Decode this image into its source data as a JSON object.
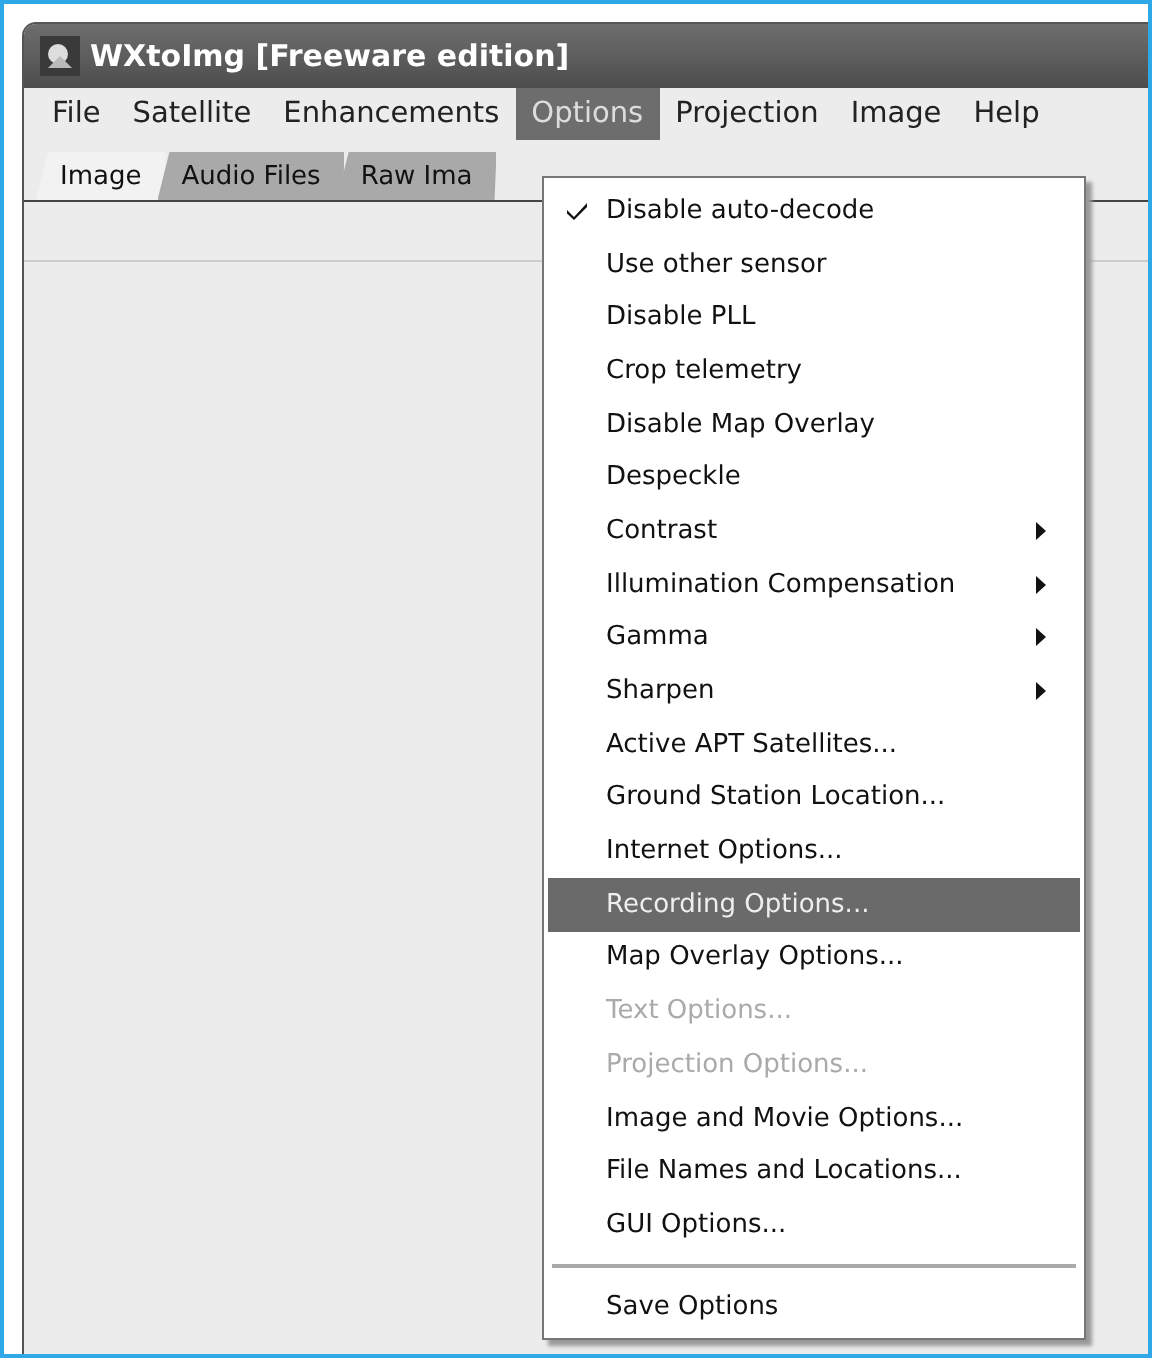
{
  "window": {
    "title": "WXtoImg [Freeware edition]"
  },
  "menubar": [
    {
      "label": "File",
      "selected": false
    },
    {
      "label": "Satellite",
      "selected": false
    },
    {
      "label": "Enhancements",
      "selected": false
    },
    {
      "label": "Options",
      "selected": true
    },
    {
      "label": "Projection",
      "selected": false
    },
    {
      "label": "Image",
      "selected": false
    },
    {
      "label": "Help",
      "selected": false
    }
  ],
  "tabs": [
    {
      "label": "Image",
      "selected": true
    },
    {
      "label": "Audio Files",
      "selected": false
    },
    {
      "label": "Raw Ima",
      "selected": false
    }
  ],
  "menu": [
    {
      "kind": "item",
      "label": "Disable auto-decode",
      "checked": true,
      "submenu": false,
      "disabled": false,
      "selected": false
    },
    {
      "kind": "item",
      "label": "Use other sensor",
      "checked": false,
      "submenu": false,
      "disabled": false,
      "selected": false
    },
    {
      "kind": "item",
      "label": "Disable PLL",
      "checked": false,
      "submenu": false,
      "disabled": false,
      "selected": false
    },
    {
      "kind": "item",
      "label": "Crop telemetry",
      "checked": false,
      "submenu": false,
      "disabled": false,
      "selected": false
    },
    {
      "kind": "item",
      "label": "Disable Map Overlay",
      "checked": false,
      "submenu": false,
      "disabled": false,
      "selected": false
    },
    {
      "kind": "item",
      "label": "Despeckle",
      "checked": false,
      "submenu": false,
      "disabled": false,
      "selected": false
    },
    {
      "kind": "item",
      "label": "Contrast",
      "checked": false,
      "submenu": true,
      "disabled": false,
      "selected": false
    },
    {
      "kind": "item",
      "label": "Illumination Compensation",
      "checked": false,
      "submenu": true,
      "disabled": false,
      "selected": false
    },
    {
      "kind": "item",
      "label": "Gamma",
      "checked": false,
      "submenu": true,
      "disabled": false,
      "selected": false
    },
    {
      "kind": "item",
      "label": "Sharpen",
      "checked": false,
      "submenu": true,
      "disabled": false,
      "selected": false
    },
    {
      "kind": "item",
      "label": "Active APT Satellites...",
      "checked": false,
      "submenu": false,
      "disabled": false,
      "selected": false
    },
    {
      "kind": "item",
      "label": "Ground Station Location...",
      "checked": false,
      "submenu": false,
      "disabled": false,
      "selected": false
    },
    {
      "kind": "item",
      "label": "Internet Options...",
      "checked": false,
      "submenu": false,
      "disabled": false,
      "selected": false
    },
    {
      "kind": "item",
      "label": "Recording Options...",
      "checked": false,
      "submenu": false,
      "disabled": false,
      "selected": true
    },
    {
      "kind": "item",
      "label": "Map Overlay Options...",
      "checked": false,
      "submenu": false,
      "disabled": false,
      "selected": false
    },
    {
      "kind": "item",
      "label": "Text Options...",
      "checked": false,
      "submenu": false,
      "disabled": true,
      "selected": false
    },
    {
      "kind": "item",
      "label": "Projection Options...",
      "checked": false,
      "submenu": false,
      "disabled": true,
      "selected": false
    },
    {
      "kind": "item",
      "label": "Image and Movie Options...",
      "checked": false,
      "submenu": false,
      "disabled": false,
      "selected": false
    },
    {
      "kind": "item",
      "label": "File Names and Locations...",
      "checked": false,
      "submenu": false,
      "disabled": false,
      "selected": false
    },
    {
      "kind": "item",
      "label": "GUI Options...",
      "checked": false,
      "submenu": false,
      "disabled": false,
      "selected": false
    },
    {
      "kind": "separator"
    },
    {
      "kind": "item",
      "label": "Save Options",
      "checked": false,
      "submenu": false,
      "disabled": false,
      "selected": false
    }
  ]
}
